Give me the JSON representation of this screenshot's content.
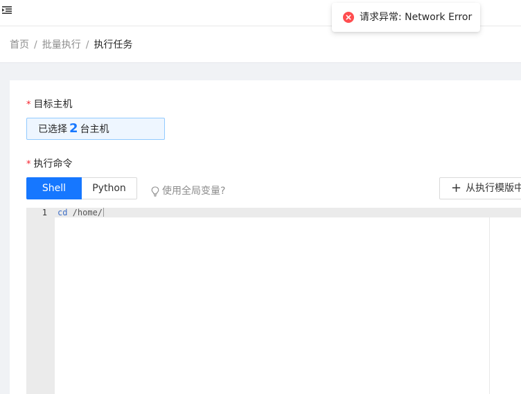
{
  "header": {
    "menu_toggle_icon": "menu-fold-icon"
  },
  "breadcrumb": {
    "home": "首页",
    "parent": "批量执行",
    "current": "执行任务",
    "separator": "/"
  },
  "form": {
    "target_hosts": {
      "required_mark": "*",
      "label": "目标主机",
      "selected_prefix": "已选择",
      "selected_count": "2",
      "selected_suffix": "台主机"
    },
    "command": {
      "required_mark": "*",
      "label": "执行命令",
      "tabs": [
        "Shell",
        "Python"
      ],
      "active_tab": "Shell",
      "global_var_hint": "使用全局变量?",
      "template_button": "从执行模版中"
    }
  },
  "editor": {
    "lines": [
      {
        "number": "1",
        "command": "cd",
        "argument": " /home/"
      }
    ]
  },
  "toast": {
    "type": "error",
    "message": "请求异常: Network Error"
  },
  "colors": {
    "primary": "#1677ff",
    "error": "#ff4d4f",
    "required": "#f5222d"
  }
}
